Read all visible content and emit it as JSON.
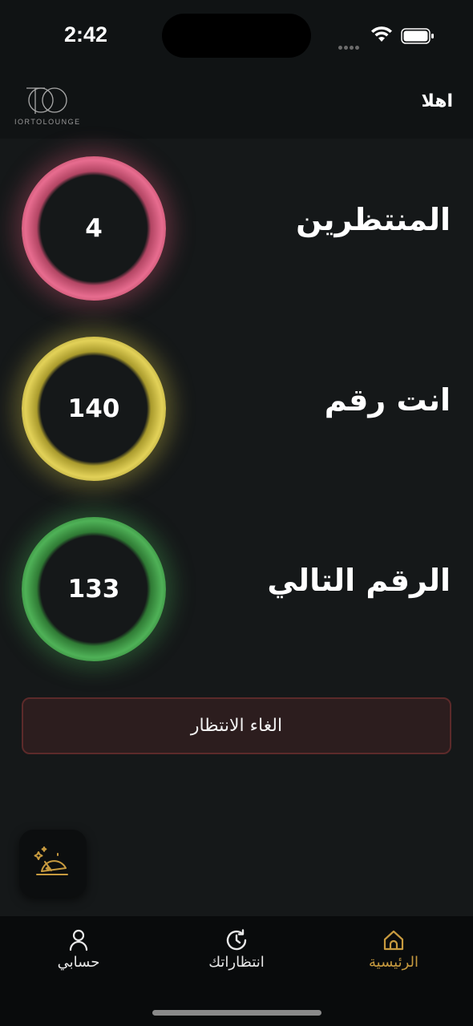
{
  "status_bar": {
    "time": "2:42"
  },
  "header": {
    "logo_text": "IORTOLOUNGE",
    "greeting": "اهلا"
  },
  "stats": [
    {
      "label": "المنتظرين",
      "value": "4",
      "color": "#e76c8f"
    },
    {
      "label": "انت رقم",
      "value": "140",
      "color": "#e2d158"
    },
    {
      "label": "الرقم التالي",
      "value": "133",
      "color": "#4fb157"
    }
  ],
  "cancel_button": {
    "label": "الغاء الانتظار"
  },
  "tabbar": {
    "tabs": [
      {
        "label": "حسابي",
        "icon": "person-icon",
        "active": false
      },
      {
        "label": "انتظاراتك",
        "icon": "history-clock-icon",
        "active": false
      },
      {
        "label": "الرئيسية",
        "icon": "home-icon",
        "active": true
      }
    ]
  },
  "colors": {
    "background": "#151819",
    "accent": "#c79a3f",
    "cancel_border": "#5c2a2a"
  }
}
